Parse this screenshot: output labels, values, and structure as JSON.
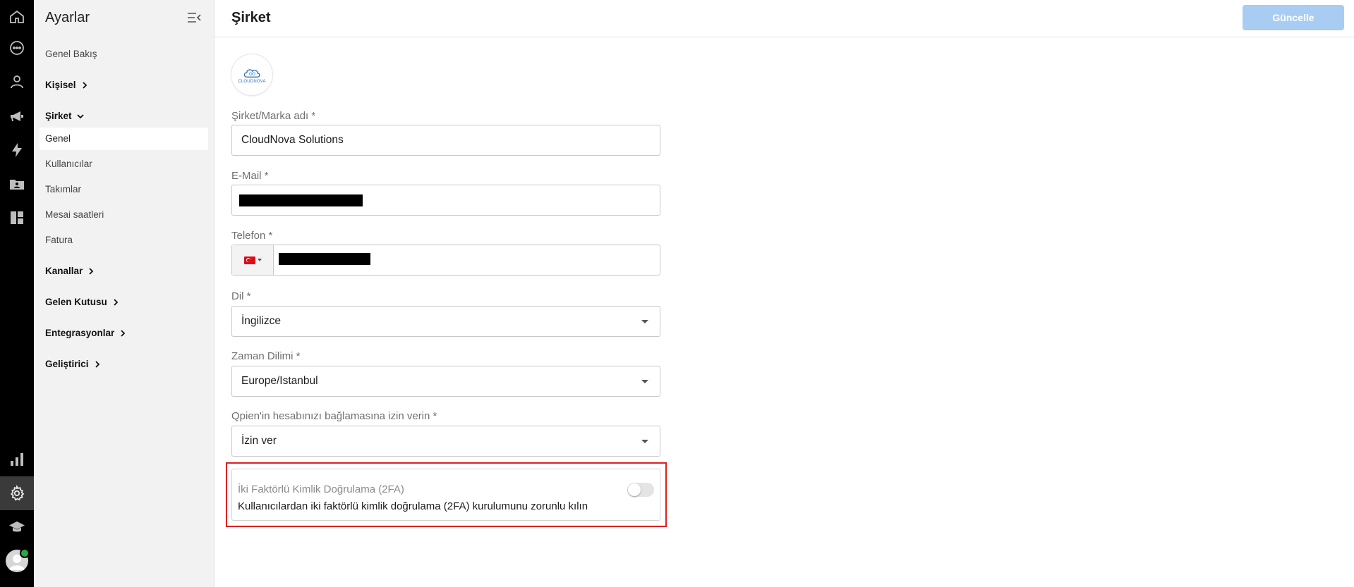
{
  "rail": {
    "icons": [
      "home-icon",
      "chat-icon",
      "contacts-icon",
      "megaphone-icon",
      "lightning-icon",
      "folder-user-icon",
      "dashboard-icon",
      "bar-chart-icon",
      "gear-icon",
      "graduation-cap-icon",
      "avatar"
    ]
  },
  "sidebar": {
    "title": "Ayarlar",
    "overview": "Genel Bakış",
    "personal": "Kişisel",
    "company": "Şirket",
    "company_items": [
      "Genel",
      "Kullanıcılar",
      "Takımlar",
      "Mesai saatleri",
      "Fatura"
    ],
    "channels": "Kanallar",
    "inbox": "Gelen Kutusu",
    "integrations": "Entegrasyonlar",
    "developer": "Geliştirici"
  },
  "header": {
    "title": "Şirket",
    "update_button": "Güncelle"
  },
  "form": {
    "logo_text": "CLOUDNOVA",
    "company_name_label": "Şirket/Marka adı *",
    "company_name_value": "CloudNova Solutions",
    "email_label": "E-Mail *",
    "phone_label": "Telefon *",
    "language_label": "Dil *",
    "language_value": "İngilizce",
    "timezone_label": "Zaman Dilimi *",
    "timezone_value": "Europe/Istanbul",
    "account_link_label": "Qpien'in hesabınızı bağlamasına izin verin *",
    "account_link_value": "İzin ver",
    "tfa_title": "İki Faktörlü Kimlik Doğrulama (2FA)",
    "tfa_description": "Kullanıcılardan iki faktörlü kimlik doğrulama (2FA) kurulumunu zorunlu kılın",
    "tfa_enabled": false
  },
  "colors": {
    "rail_bg": "#000000",
    "sidebar_bg": "#f2f2f2",
    "primary_disabled": "#a9ccf3",
    "highlight": "#e02020",
    "online": "#2aa745"
  }
}
